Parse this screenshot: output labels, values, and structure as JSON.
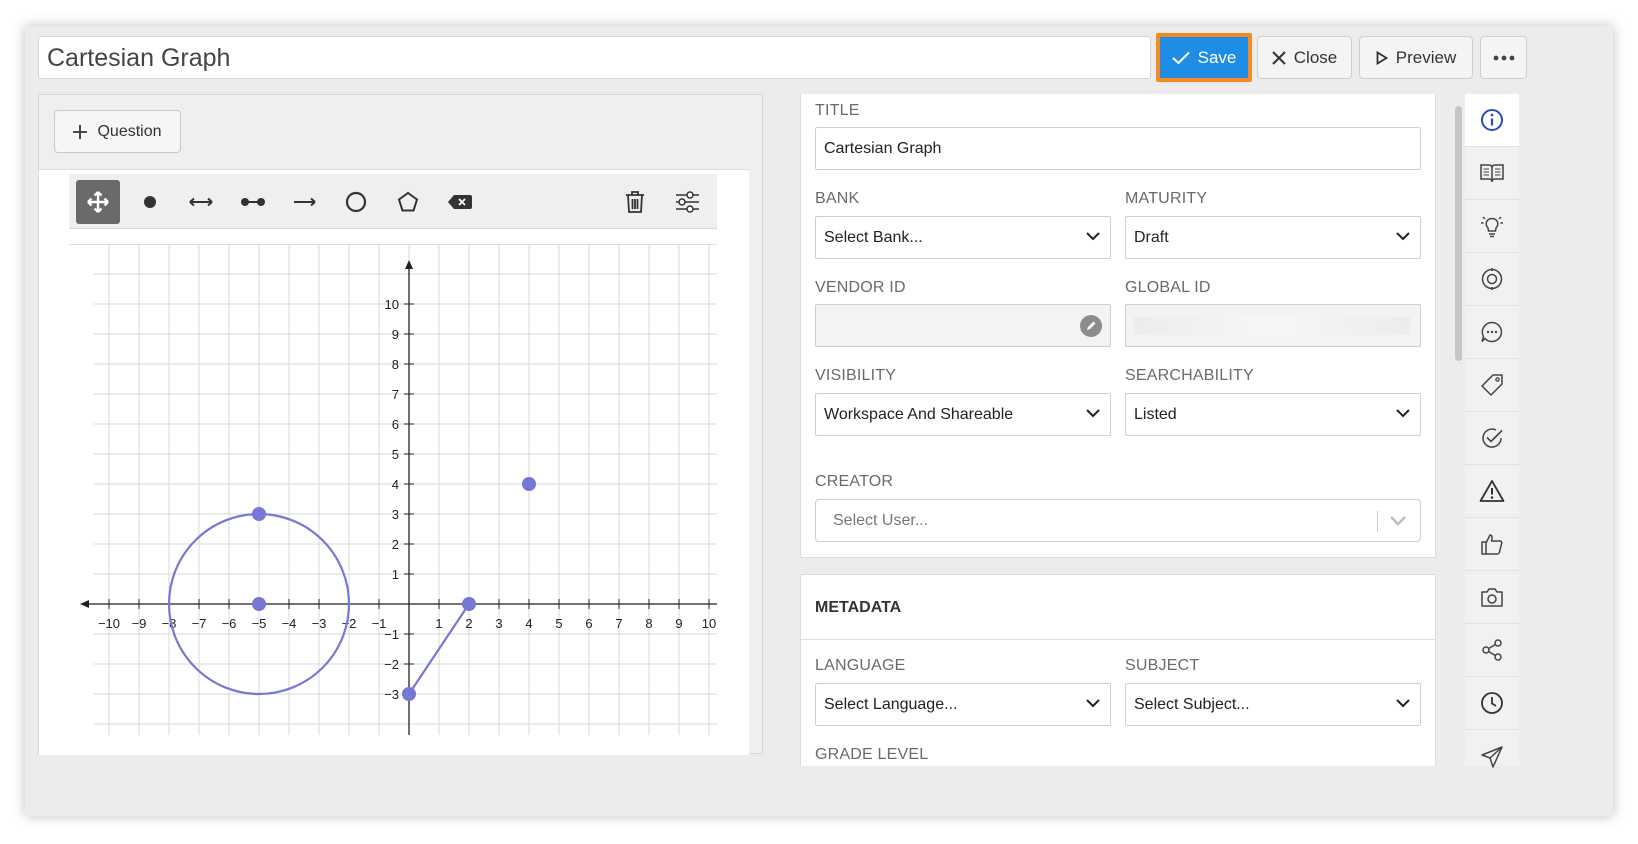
{
  "header": {
    "title_value": "Cartesian Graph",
    "save_label": "Save",
    "close_label": "Close",
    "preview_label": "Preview",
    "accent": "#1f8ce6",
    "highlight": "#f58a22"
  },
  "left": {
    "question_label": "Question",
    "toolbar_tools": [
      "move-icon",
      "point-icon",
      "line-icon",
      "segment-icon",
      "ray-icon",
      "circle-icon",
      "polygon-icon",
      "delete-mark-icon"
    ],
    "toolbar_right": [
      "trash-icon",
      "settings-sliders-icon"
    ]
  },
  "graph": {
    "x_range": [
      -10,
      10
    ],
    "y_range": [
      -3,
      10
    ],
    "x_ticks": [
      "-10",
      "-9",
      "-8",
      "-7",
      "-6",
      "-5",
      "-4",
      "-3",
      "-2",
      "-1",
      "1",
      "2",
      "3",
      "4",
      "5",
      "6",
      "7",
      "8",
      "9",
      "10"
    ],
    "y_ticks": [
      "10",
      "9",
      "8",
      "7",
      "6",
      "5",
      "4",
      "3",
      "2",
      "1",
      "-1",
      "-2",
      "-3"
    ],
    "circle": {
      "center": [
        -5,
        0
      ],
      "edge": [
        -5,
        3
      ]
    },
    "segment": [
      [
        0,
        -3
      ],
      [
        2,
        0
      ]
    ],
    "point": [
      4,
      4
    ],
    "color": "#7777d6"
  },
  "form": {
    "title_label": "TITLE",
    "title_value": "Cartesian Graph",
    "bank_label": "BANK",
    "bank_value": "Select Bank...",
    "maturity_label": "MATURITY",
    "maturity_value": "Draft",
    "vendor_label": "VENDOR ID",
    "vendor_value": "",
    "global_label": "GLOBAL ID",
    "global_value": "",
    "visibility_label": "VISIBILITY",
    "visibility_value": "Workspace And Shareable",
    "search_label": "SEARCHABILITY",
    "search_value": "Listed",
    "creator_label": "CREATOR",
    "creator_value": "Select User..."
  },
  "metadata": {
    "heading": "METADATA",
    "language_label": "LANGUAGE",
    "language_value": "Select Language...",
    "subject_label": "SUBJECT",
    "subject_value": "Select Subject...",
    "grade_label": "GRADE LEVEL"
  },
  "sidebar": [
    "info-icon",
    "book-icon",
    "lightbulb-icon",
    "target-icon",
    "comment-icon",
    "tag-icon",
    "check-circle-icon",
    "warning-icon",
    "thumbs-up-icon",
    "camera-icon",
    "share-icon",
    "clock-icon",
    "send-icon"
  ]
}
